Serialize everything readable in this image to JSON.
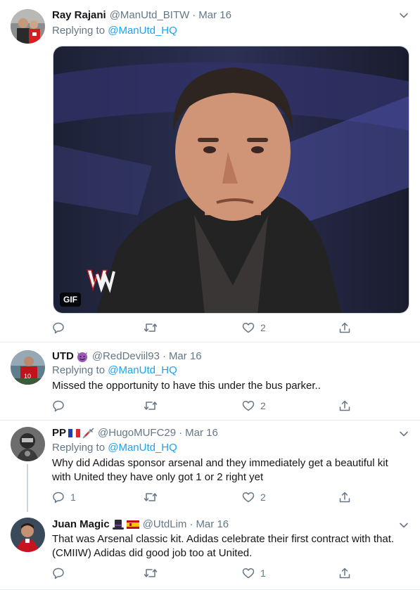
{
  "tweets": [
    {
      "name": "Ray Rajani",
      "handle": "@ManUtd_BITW",
      "date": "Mar 16",
      "replying_label": "Replying to",
      "replying_to": "@ManUtd_HQ",
      "media_badge": "GIF",
      "likes": "2"
    },
    {
      "name": "UTD",
      "handle": "@RedDeviil93",
      "date": "Mar 16",
      "replying_label": "Replying to",
      "replying_to": "@ManUtd_HQ",
      "text": "Missed the opportunity to have this under the bus parker..",
      "likes": "2"
    },
    {
      "name": "PP",
      "handle": "@HugoMUFC29",
      "date": "Mar 16",
      "replying_label": "Replying to",
      "replying_to": "@ManUtd_HQ",
      "text_line1": "Why did Adidas sponsor arsenal and they immediately get a beautiful kit",
      "text_line2": "with United they have only got 1 or 2 right yet",
      "replies": "1",
      "likes": "2"
    },
    {
      "name": "Juan Magic",
      "handle": "@UtdLim",
      "date": "Mar 16",
      "text_line1": "That was Arsenal classic kit. Adidas celebrate their first contract with that.",
      "text_line2": "(CMIIW) Adidas did good job too at United.",
      "likes": "1"
    }
  ],
  "separator": "·",
  "icons": {
    "reply": "reply-icon",
    "retweet": "retweet-icon",
    "like": "heart-icon",
    "share": "share-icon",
    "more": "chevron-down-icon"
  },
  "colors": {
    "link": "#1da1f2",
    "secondary_text": "#657786",
    "border": "#e6ecf0"
  }
}
